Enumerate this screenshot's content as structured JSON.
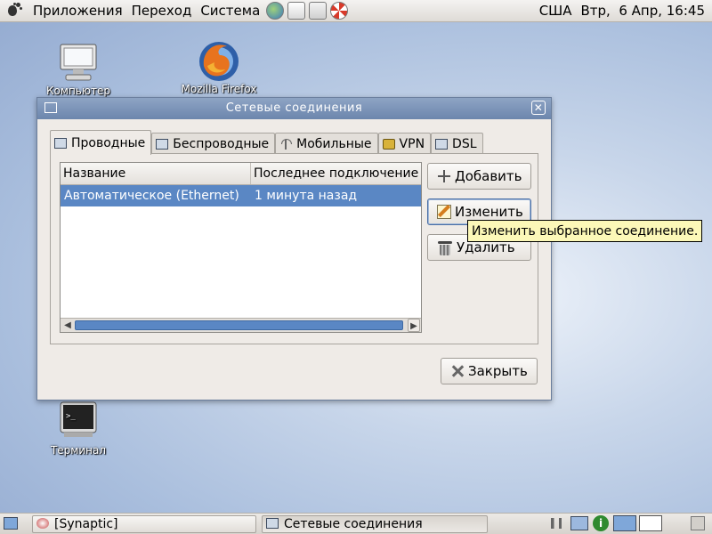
{
  "top_panel": {
    "menus": [
      "Приложения",
      "Переход",
      "Система"
    ],
    "keyboard_layout": "США",
    "datetime": "Втр,  6 Апр, 16:45"
  },
  "desktop": {
    "icons": [
      {
        "label": "Компьютер"
      },
      {
        "label": "Mozilla Firefox"
      },
      {
        "label": "Терминал"
      }
    ]
  },
  "window": {
    "title": "Сетевые соединения",
    "tabs": [
      {
        "label": "Проводные"
      },
      {
        "label": "Беспроводные"
      },
      {
        "label": "Мобильные"
      },
      {
        "label": "VPN"
      },
      {
        "label": "DSL"
      }
    ],
    "list": {
      "columns": [
        "Название",
        "Последнее подключение"
      ],
      "rows": [
        {
          "name": "Автоматическое (Ethernet)",
          "last": "1 минута назад"
        }
      ]
    },
    "buttons": {
      "add": "Добавить",
      "edit": "Изменить",
      "delete": "Удалить",
      "close": "Закрыть"
    }
  },
  "tooltip": "Изменить выбранное соединение.",
  "bottom_panel": {
    "tasks": [
      "[Synaptic]",
      "Сетевые соединения"
    ]
  }
}
